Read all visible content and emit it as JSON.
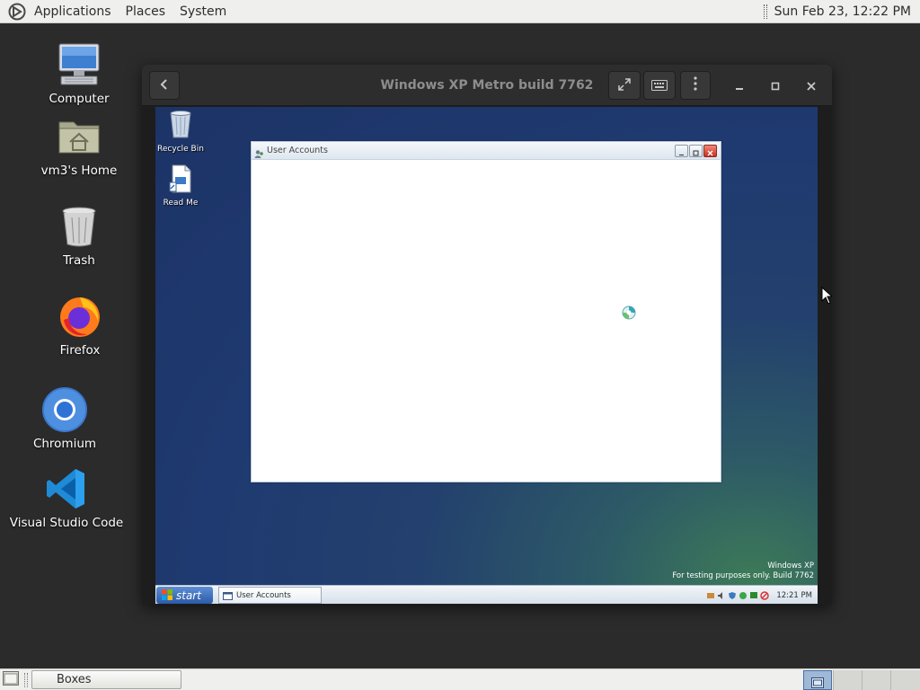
{
  "top_panel": {
    "menu": [
      "Applications",
      "Places",
      "System"
    ],
    "clock": "Sun Feb 23, 12:22 PM"
  },
  "desktop_icons": [
    {
      "label": "Computer",
      "icon": "computer-icon"
    },
    {
      "label": "vm3's Home",
      "icon": "home-folder-icon"
    },
    {
      "label": "Trash",
      "icon": "trash-icon"
    },
    {
      "label": "Firefox",
      "icon": "firefox-icon"
    },
    {
      "label": "Chromium",
      "icon": "chromium-icon"
    },
    {
      "label": "Visual Studio Code",
      "icon": "vscode-icon"
    }
  ],
  "boxes_window": {
    "title": "Windows XP Metro build 7762"
  },
  "vm": {
    "desktop_icons": [
      {
        "label": "Recycle Bin",
        "icon": "recycle-bin-icon"
      },
      {
        "label": "Read Me",
        "icon": "read-me-icon"
      }
    ],
    "dialog": {
      "title": "User Accounts"
    },
    "taskbar": {
      "start_label": "start",
      "task_label": "User Accounts",
      "time": "12:21 PM"
    },
    "branding": {
      "line1": "Windows XP",
      "line2": "For testing purposes only. Build 7762"
    }
  },
  "bottom_panel": {
    "task_label": "Boxes"
  },
  "colors": {
    "panel_bg": "#efefed",
    "desktop_bg": "#2b2b2b",
    "header_bg": "#2d2d2d",
    "xp_desktop": "#1f3a70",
    "xp_start": "#2c5aa8"
  }
}
